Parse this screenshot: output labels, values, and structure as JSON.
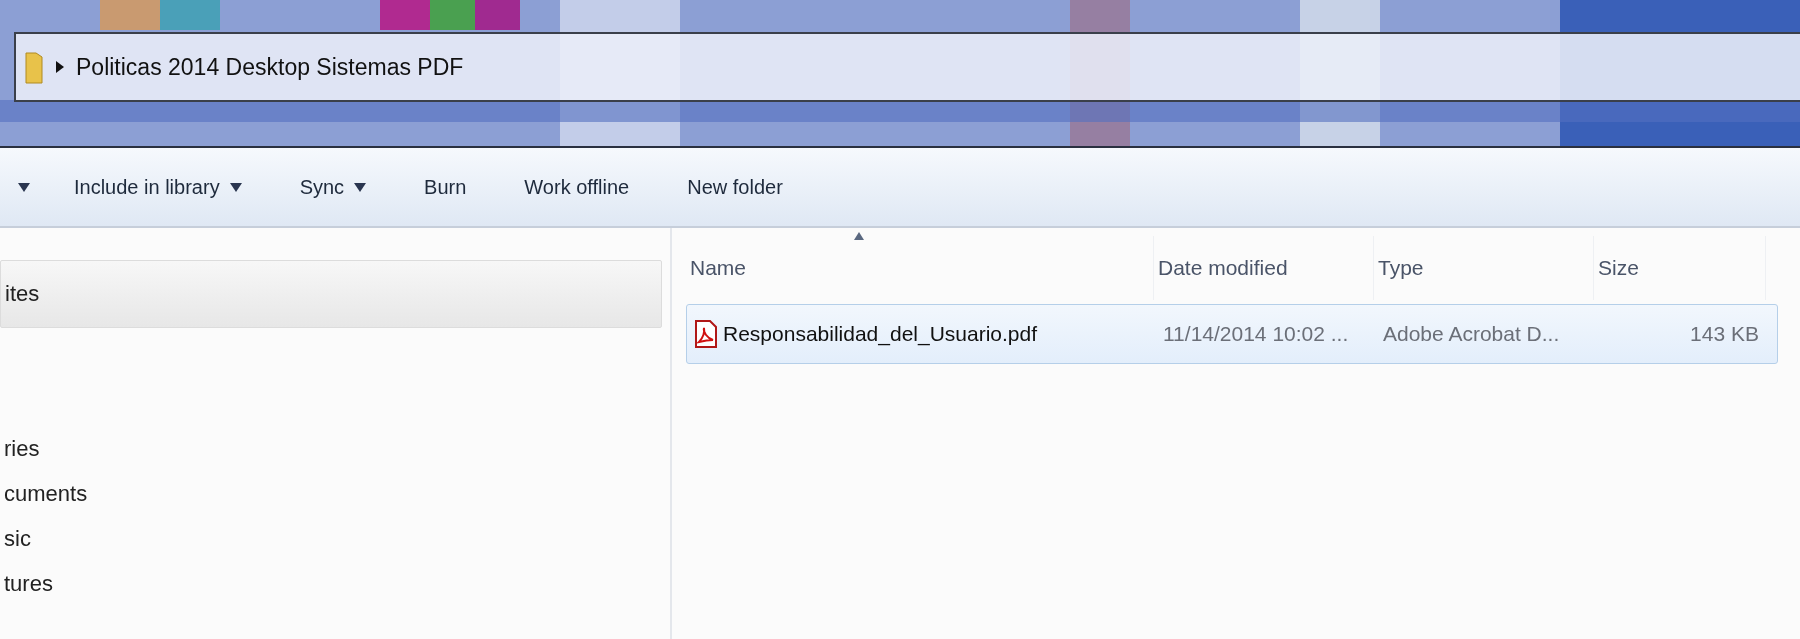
{
  "address_bar": {
    "path": "Politicas 2014 Desktop Sistemas PDF"
  },
  "toolbar": [
    {
      "kind": "caret",
      "dropdown": true
    },
    {
      "kind": "button",
      "label": "Include in library",
      "dropdown": true
    },
    {
      "kind": "button",
      "label": "Sync",
      "dropdown": true
    },
    {
      "kind": "button",
      "label": "Burn",
      "dropdown": false
    },
    {
      "kind": "button",
      "label": "Work offline",
      "dropdown": false
    },
    {
      "kind": "button",
      "label": "New folder",
      "dropdown": false
    }
  ],
  "sidebar": {
    "items": [
      {
        "label": "ites",
        "selected": true
      },
      {
        "label": "ries",
        "selected": false
      },
      {
        "label": "cuments",
        "selected": false
      },
      {
        "label": "sic",
        "selected": false
      },
      {
        "label": "tures",
        "selected": false
      }
    ]
  },
  "table": {
    "columns": [
      {
        "label": "Name",
        "sorted": true
      },
      {
        "label": "Date modified",
        "sorted": false
      },
      {
        "label": "Type",
        "sorted": false
      },
      {
        "label": "Size",
        "sorted": false
      }
    ],
    "rows": [
      {
        "name": "Responsabilidad_del_Usuario.pdf",
        "date_modified": "11/14/2014 10:02 ...",
        "type": "Adobe Acrobat D...",
        "size": "143 KB",
        "selected": true
      }
    ]
  }
}
